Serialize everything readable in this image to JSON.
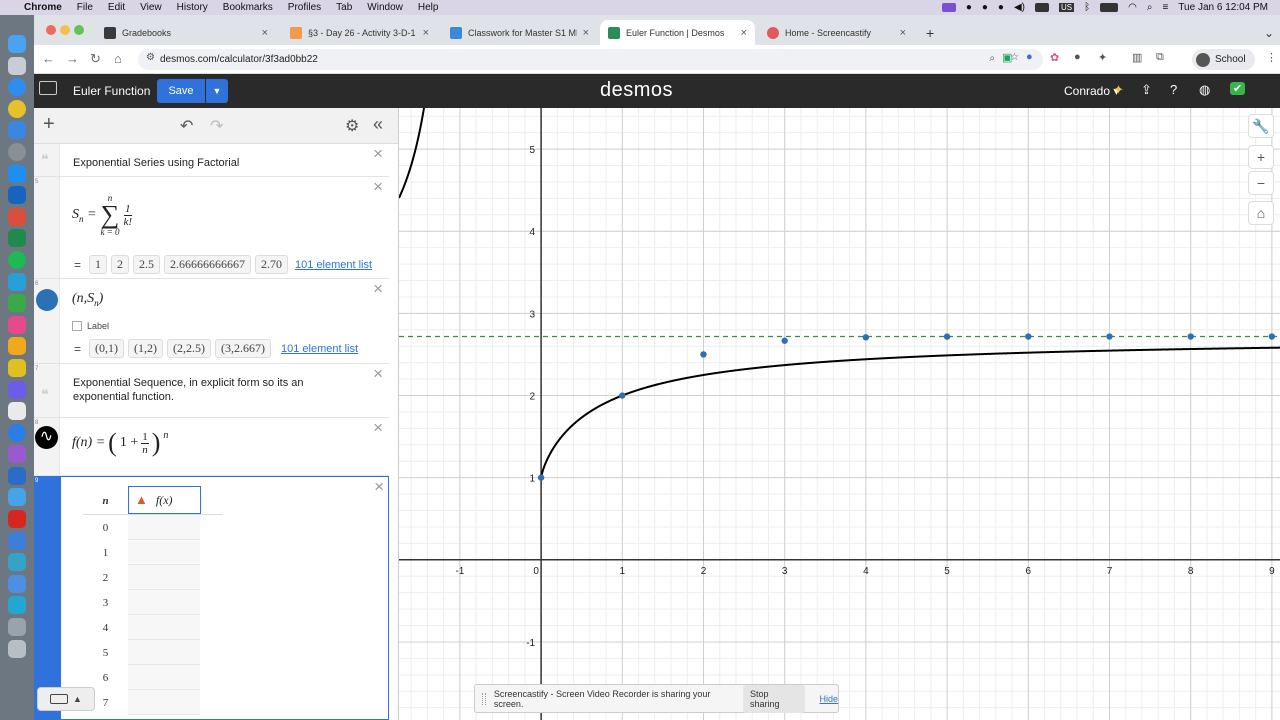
{
  "menubar": {
    "app": "Chrome",
    "items": [
      "File",
      "Edit",
      "View",
      "History",
      "Bookmarks",
      "Profiles",
      "Tab",
      "Window",
      "Help"
    ],
    "input_source": "US",
    "clock": "Tue Jan 6  12:04 PM"
  },
  "tabs": [
    {
      "title": "Gradebooks",
      "color": "#3a3a3a"
    },
    {
      "title": "§3 - Day 26 - Activity 3-D-1",
      "color": "#f2994a"
    },
    {
      "title": "Classwork for Master S1 MRW",
      "color": "#3b8ad9"
    },
    {
      "title": "Euler Function | Desmos",
      "color": "#2e8b57",
      "active": true
    },
    {
      "title": "Home - Screencastify",
      "color": "#e05a5a"
    }
  ],
  "address": {
    "url": "desmos.com/calculator/3f3ad0bb22"
  },
  "profile": {
    "label": "School"
  },
  "desmos": {
    "graph_title": "Euler Function",
    "save_label": "Save",
    "logo": "desmos",
    "user": "Conrado"
  },
  "expressions": {
    "note4": "Exponential Series using Factorial",
    "e5": {
      "num": "5",
      "lhs": "S",
      "lhs_sub": "n",
      "sum_top": "n",
      "sum_bottom": "k = 0",
      "frac_top": "1",
      "frac_bottom": "k!",
      "values": [
        "1",
        "2",
        "2.5",
        "2.66666666667",
        "2.70"
      ],
      "list_link": "101 element list"
    },
    "e6": {
      "num": "6",
      "text": "(n,S",
      "sub": "n",
      "close": ")",
      "label_text": "Label",
      "values": [
        "(0,1)",
        "(1,2)",
        "(2,2.5)",
        "(3,2.667)"
      ],
      "list_link": "101 element list"
    },
    "note7": {
      "num": "7",
      "text": "Exponential Sequence, in explicit form so its an exponential function."
    },
    "e8": {
      "num": "8",
      "lhs": "f(n) =",
      "one": "1 +",
      "frac_top": "1",
      "frac_bottom": "n",
      "exp": "n"
    },
    "table9": {
      "num": "9",
      "col1": "n",
      "col2": "f(x)",
      "rows": [
        "0",
        "1",
        "2",
        "3",
        "4",
        "5",
        "6",
        "7"
      ]
    }
  },
  "chart_data": {
    "type": "scatter",
    "xlim": [
      -1.75,
      9.1
    ],
    "ylim": [
      -1.95,
      5.5
    ],
    "grid": true,
    "x_ticks": [
      "-1",
      "0",
      "1",
      "2",
      "3",
      "4",
      "5",
      "6",
      "7",
      "8",
      "9"
    ],
    "y_ticks": [
      "-1",
      "1",
      "2",
      "3",
      "4",
      "5"
    ],
    "points": [
      {
        "x": 0,
        "y": 1
      },
      {
        "x": 1,
        "y": 2
      },
      {
        "x": 2,
        "y": 2.5
      },
      {
        "x": 3,
        "y": 2.667
      },
      {
        "x": 4,
        "y": 2.708
      },
      {
        "x": 5,
        "y": 2.717
      },
      {
        "x": 6,
        "y": 2.718
      },
      {
        "x": 7,
        "y": 2.718
      },
      {
        "x": 8,
        "y": 2.718
      },
      {
        "x": 9,
        "y": 2.718
      }
    ],
    "curve": "f(n) = (1 + 1/n)^n",
    "asymptote_y": 2.718,
    "colors": {
      "points": "#2d70b3",
      "curve": "#000000",
      "asymptote": "#388c46"
    }
  },
  "share_bar": {
    "message": "Screencastify - Screen Video Recorder is sharing your screen.",
    "stop": "Stop sharing",
    "hide": "Hide"
  }
}
